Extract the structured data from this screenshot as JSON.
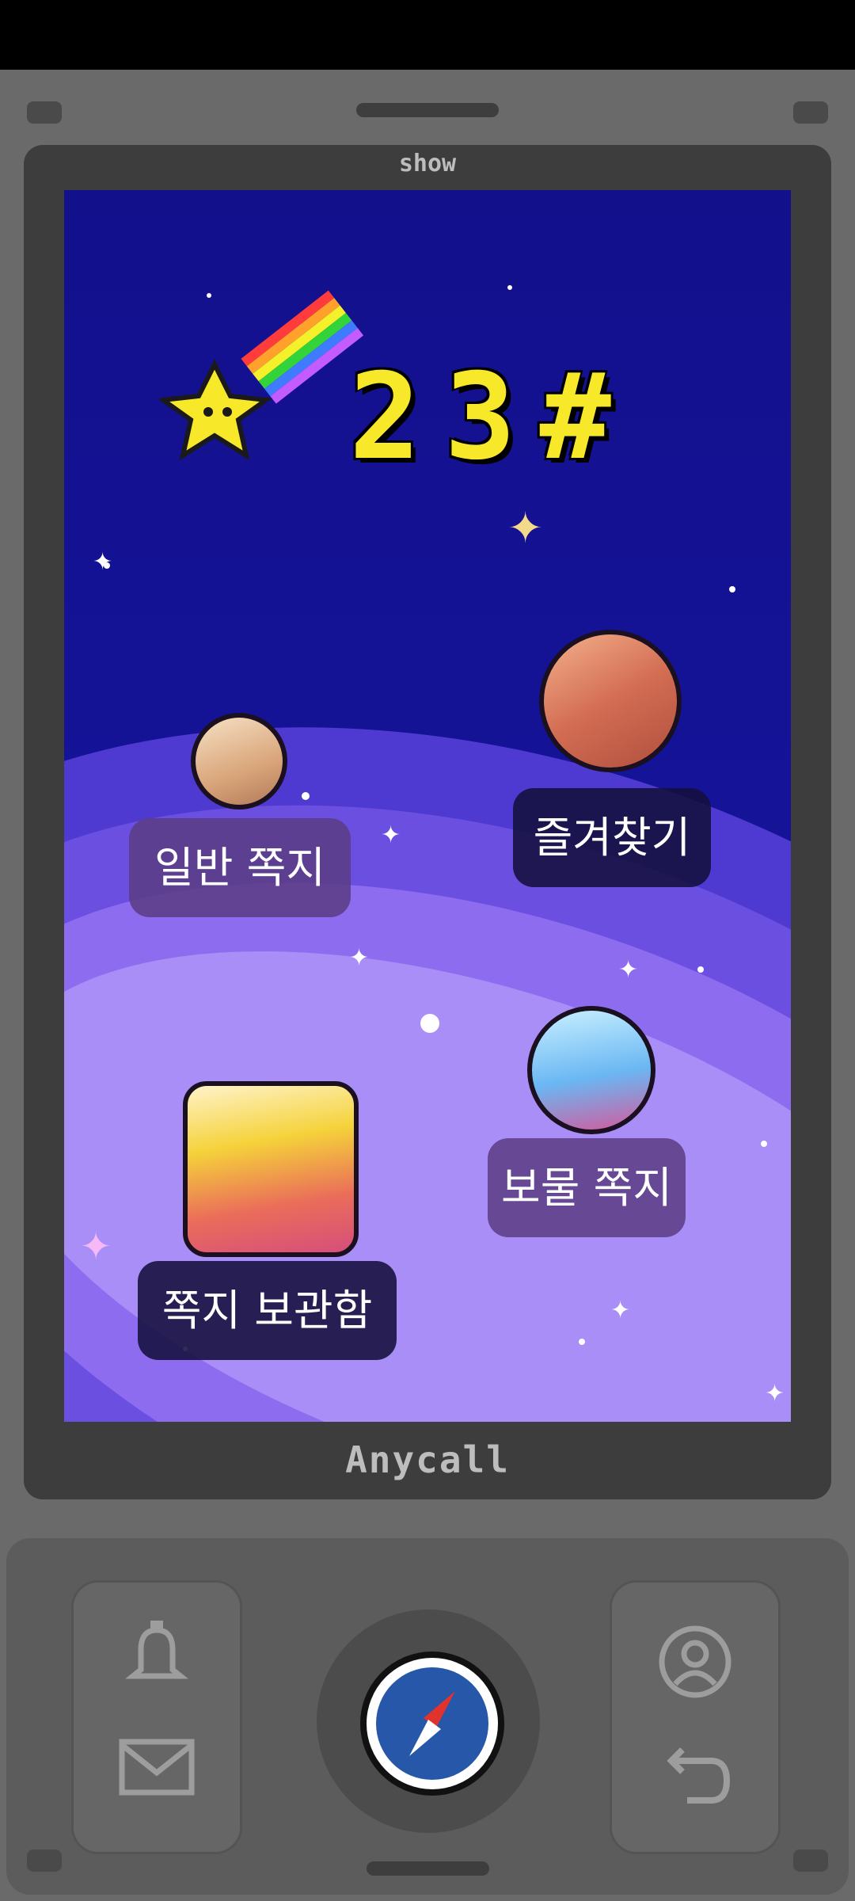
{
  "device": {
    "brand_top": "show",
    "brand_bottom": "Anycall"
  },
  "screen": {
    "counter_text": "23#",
    "menu": {
      "normal_note": "일반 쪽지",
      "favorites": "즐겨찾기",
      "treasure_note": "보물 쪽지",
      "note_archive": "쪽지 보관함"
    }
  },
  "keypad": {
    "left_top_icon": "bell-icon",
    "left_bottom_icon": "mail-icon",
    "center_icon": "compass-icon",
    "right_top_icon": "profile-icon",
    "right_bottom_icon": "back-icon"
  }
}
